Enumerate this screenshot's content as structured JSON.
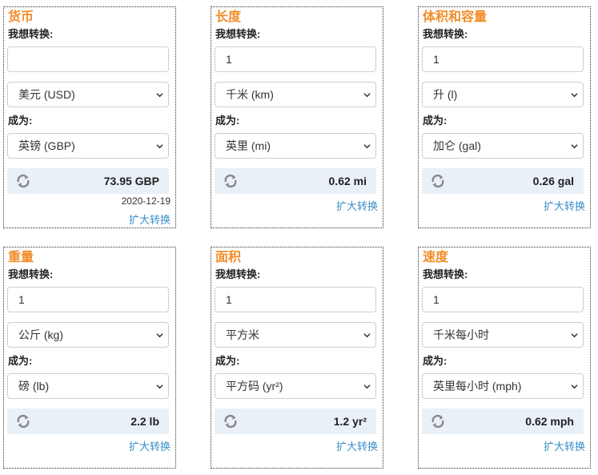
{
  "cards": [
    {
      "title": "货币",
      "from_label": "我想转换:",
      "input_value": "",
      "from_unit": "美元 (USD)",
      "to_label": "成为:",
      "to_unit": "英镑 (GBP)",
      "result": "73.95 GBP",
      "date": "2020-12-19",
      "expand": "扩大转换"
    },
    {
      "title": "长度",
      "from_label": "我想转换:",
      "input_value": "1",
      "from_unit": "千米 (km)",
      "to_label": "成为:",
      "to_unit": "英里 (mi)",
      "result": "0.62 mi",
      "expand": "扩大转换"
    },
    {
      "title": "体积和容量",
      "from_label": "我想转换:",
      "input_value": "1",
      "from_unit": "升 (l)",
      "to_label": "成为:",
      "to_unit": "加仑 (gal)",
      "result": "0.26 gal",
      "expand": "扩大转换"
    },
    {
      "title": "重量",
      "from_label": "我想转换:",
      "input_value": "1",
      "from_unit": "公斤 (kg)",
      "to_label": "成为:",
      "to_unit": "磅 (lb)",
      "result": "2.2 lb",
      "expand": "扩大转换"
    },
    {
      "title": "面积",
      "from_label": "我想转换:",
      "input_value": "1",
      "from_unit": "平方米",
      "to_label": "成为:",
      "to_unit": "平方码 (yr²)",
      "result": "1.2 yr²",
      "expand": "扩大转换"
    },
    {
      "title": "速度",
      "from_label": "我想转换:",
      "input_value": "1",
      "from_unit": "千米每小时",
      "to_label": "成为:",
      "to_unit": "英里每小时 (mph)",
      "result": "0.62 mph",
      "expand": "扩大转换"
    }
  ],
  "icons": {
    "refresh": "refresh-icon",
    "chevron": "chevron-down-icon"
  },
  "colors": {
    "title": "#f28c28",
    "link": "#3a8ec8",
    "result_bg": "#e9f0f8"
  }
}
